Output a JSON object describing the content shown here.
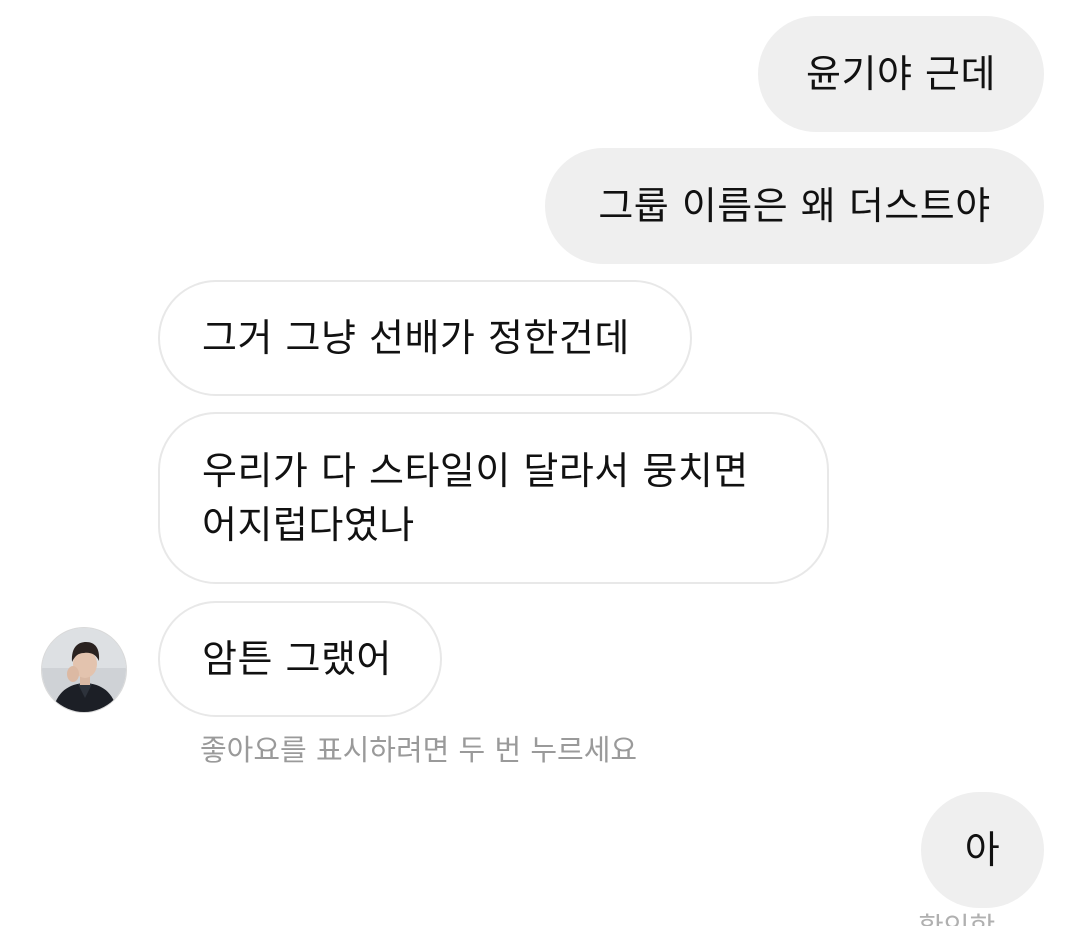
{
  "chat": {
    "messages": [
      {
        "sender": "me",
        "text": "윤기야 근데"
      },
      {
        "sender": "me",
        "text": "그룹 이름은 왜 더스트야"
      },
      {
        "sender": "other",
        "text": "그거 그냥 선배가 정한건데"
      },
      {
        "sender": "other",
        "line1": "우리가 다 스타일이 달라서 뭉치면",
        "line2": "어지럽다였나"
      },
      {
        "sender": "other",
        "text": "암튼 그랬어"
      },
      {
        "sender": "me",
        "text": "아"
      }
    ],
    "like_hint": "좋아요를 표시하려면 두 번 누르세요",
    "seen_status": "확인함"
  },
  "colors": {
    "sent_bubble": "#efefef",
    "received_border": "#e8e8e8",
    "hint_text": "#9a9a9a"
  },
  "icons": {
    "avatar": "profile-photo"
  }
}
